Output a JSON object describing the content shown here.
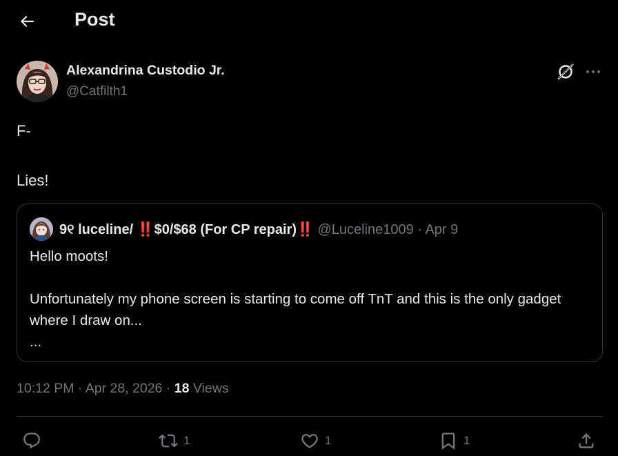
{
  "header": {
    "title": "Post"
  },
  "author": {
    "name": "Alexandrina Custodio Jr.",
    "handle": "@Catfilth1"
  },
  "post": {
    "text": "F-\n\nLies!"
  },
  "quote": {
    "name": "9୧ luceline/ ‼️$0/$68 (For CP repair)‼️",
    "handle": "@Luceline1009",
    "dot": "·",
    "date": "Apr 9",
    "text": "Hello moots!\n\nUnfortunately my phone screen is starting to come off TnT and this is the only gadget where I draw on...\n..."
  },
  "meta": {
    "time": "10:12 PM",
    "dot": "·",
    "date": "Apr 28, 2026",
    "views_count": "18",
    "views_label": "Views"
  },
  "actions": {
    "reply_count": "",
    "repost_count": "1",
    "like_count": "1",
    "bookmark_count": "1"
  },
  "icons": [
    "back-arrow-icon",
    "grok-icon",
    "more-icon",
    "reply-icon",
    "repost-icon",
    "like-icon",
    "bookmark-icon",
    "share-icon"
  ]
}
